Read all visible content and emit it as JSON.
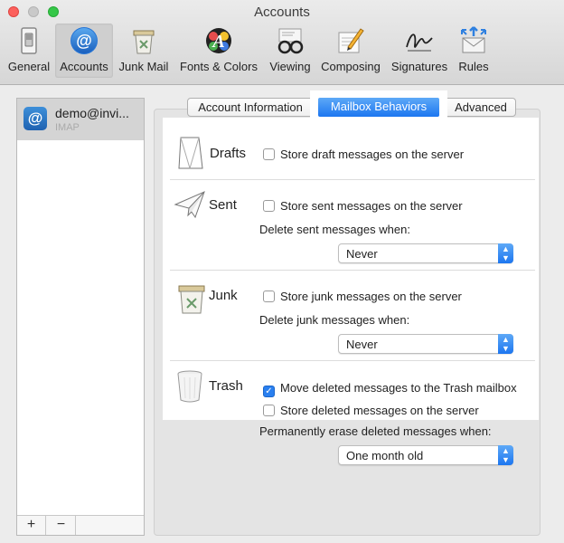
{
  "window": {
    "title": "Accounts"
  },
  "toolbar": {
    "items": [
      {
        "label": "General",
        "icon": "switch-icon"
      },
      {
        "label": "Accounts",
        "icon": "at-sign-icon"
      },
      {
        "label": "Junk Mail",
        "icon": "junk-bin-icon"
      },
      {
        "label": "Fonts & Colors",
        "icon": "fonts-colors-icon"
      },
      {
        "label": "Viewing",
        "icon": "glasses-icon"
      },
      {
        "label": "Composing",
        "icon": "pencil-note-icon"
      },
      {
        "label": "Signatures",
        "icon": "signature-icon"
      },
      {
        "label": "Rules",
        "icon": "rules-envelope-icon"
      }
    ]
  },
  "sidebar": {
    "account": {
      "name": "demo@invi...",
      "type": "IMAP"
    },
    "add_label": "+",
    "remove_label": "−"
  },
  "tabs": {
    "account_info": "Account Information",
    "mailbox_behaviors": "Mailbox Behaviors",
    "advanced": "Advanced"
  },
  "drafts": {
    "title": "Drafts",
    "store_label": "Store draft messages on the server",
    "store_checked": false
  },
  "sent": {
    "title": "Sent",
    "store_label": "Store sent messages on the server",
    "store_checked": false,
    "delete_label": "Delete sent messages when:",
    "delete_value": "Never"
  },
  "junk": {
    "title": "Junk",
    "store_label": "Store junk messages on the server",
    "store_checked": false,
    "delete_label": "Delete junk messages when:",
    "delete_value": "Never"
  },
  "trash": {
    "title": "Trash",
    "move_label": "Move deleted messages to the Trash mailbox",
    "move_checked": true,
    "store_label": "Store deleted messages on the server",
    "store_checked": false,
    "erase_label": "Permanently erase deleted messages when:",
    "erase_value": "One month old"
  },
  "colors": {
    "accent": "#1c76f0",
    "selection": "#d4d4d4"
  }
}
